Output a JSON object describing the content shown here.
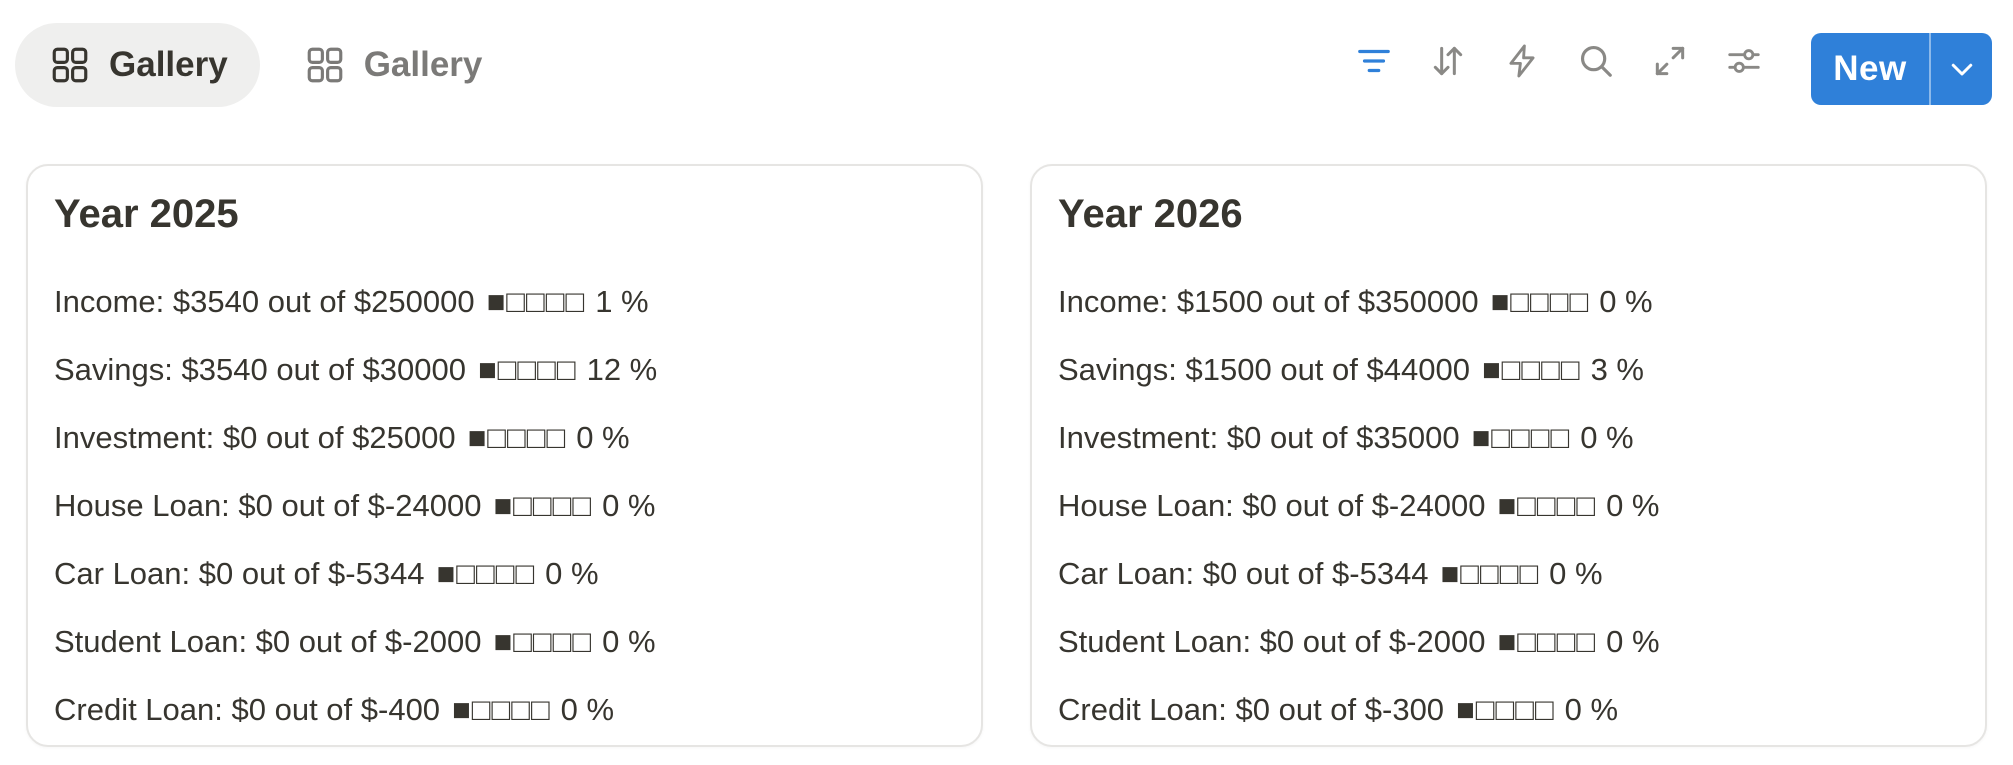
{
  "tabs": [
    {
      "label": "Gallery",
      "active": true
    },
    {
      "label": "Gallery",
      "active": false
    }
  ],
  "toolbar": {
    "icons": [
      "filter-icon",
      "sort-icon",
      "automation-icon",
      "search-icon",
      "expand-icon",
      "settings-icon"
    ],
    "accent": "#2f80d9"
  },
  "new_button": {
    "label": "New"
  },
  "cards": [
    {
      "title": "Year 2025",
      "rows": [
        {
          "label": "Income: $3540 out of $250000",
          "bar": "■□□□□",
          "pct": "1 %"
        },
        {
          "label": "Savings: $3540 out of $30000",
          "bar": "■□□□□",
          "pct": "12 %"
        },
        {
          "label": "Investment: $0 out of $25000",
          "bar": "■□□□□",
          "pct": "0 %"
        },
        {
          "label": "House Loan: $0 out of $-24000",
          "bar": "■□□□□",
          "pct": "0 %"
        },
        {
          "label": "Car Loan: $0 out of $-5344",
          "bar": "■□□□□",
          "pct": "0 %"
        },
        {
          "label": "Student Loan: $0 out of $-2000",
          "bar": "■□□□□",
          "pct": "0 %"
        },
        {
          "label": "Credit Loan: $0 out of $-400",
          "bar": "■□□□□",
          "pct": "0 %"
        }
      ]
    },
    {
      "title": "Year 2026",
      "rows": [
        {
          "label": "Income: $1500 out of $350000",
          "bar": "■□□□□",
          "pct": "0 %"
        },
        {
          "label": "Savings: $1500 out of $44000",
          "bar": "■□□□□",
          "pct": "3 %"
        },
        {
          "label": "Investment: $0 out of $35000",
          "bar": "■□□□□",
          "pct": "0 %"
        },
        {
          "label": "House Loan: $0 out of $-24000",
          "bar": "■□□□□",
          "pct": "0 %"
        },
        {
          "label": "Car Loan: $0 out of $-5344",
          "bar": "■□□□□",
          "pct": "0 %"
        },
        {
          "label": "Student Loan: $0 out of $-2000",
          "bar": "■□□□□",
          "pct": "0 %"
        },
        {
          "label": "Credit Loan: $0 out of $-300",
          "bar": "■□□□□",
          "pct": "0 %"
        }
      ]
    }
  ]
}
